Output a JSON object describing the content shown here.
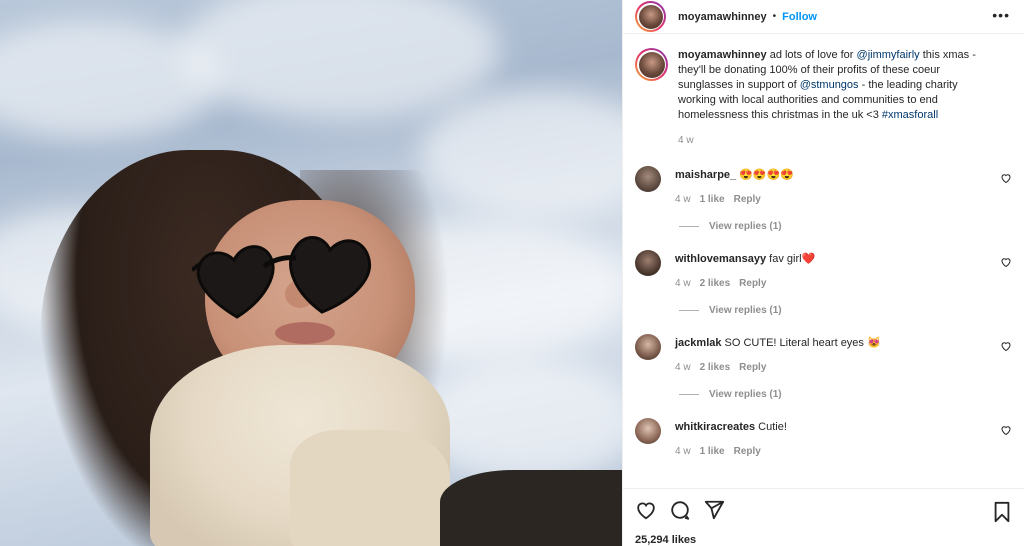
{
  "header": {
    "username": "moyamawhinney",
    "separator": "•",
    "follow_label": "Follow",
    "more_label": "•••"
  },
  "caption": {
    "username": "moyamawhinney",
    "text_1": " ad lots of love for ",
    "mention_1": "@jimmyfairly",
    "text_2": " this xmas - they'll be donating 100% of their profits of these coeur sunglasses in support of ",
    "mention_2": "@stmungos",
    "text_3": " - the leading charity working with local authorities and communities to end homelessness this christmas in the uk <3 ",
    "hashtag": "#xmasforall",
    "time": "4 w"
  },
  "comments": [
    {
      "username": "maisharpe_",
      "text": " 😍😍😍😍",
      "time": "4 w",
      "likes": "1 like",
      "reply": "Reply",
      "view_replies": "View replies (1)"
    },
    {
      "username": "withlovemansayy",
      "text": " fav girl❤️",
      "time": "4 w",
      "likes": "2 likes",
      "reply": "Reply",
      "view_replies": "View replies (1)"
    },
    {
      "username": "jackmlak",
      "text": " SO CUTE! Literal heart eyes 😻",
      "time": "4 w",
      "likes": "2 likes",
      "reply": "Reply",
      "view_replies": "View replies (1)"
    },
    {
      "username": "whitkiracreates",
      "text": " Cutie!",
      "time": "4 w",
      "likes": "1 like",
      "reply": "Reply"
    }
  ],
  "actions": {
    "like_icon": "heart-icon",
    "comment_icon": "comment-icon",
    "share_icon": "send-icon",
    "save_icon": "bookmark-icon",
    "likes_count": "25,294 likes"
  },
  "colors": {
    "accent": "#0095f6",
    "link": "#00376b",
    "muted": "#8e8e8e"
  }
}
